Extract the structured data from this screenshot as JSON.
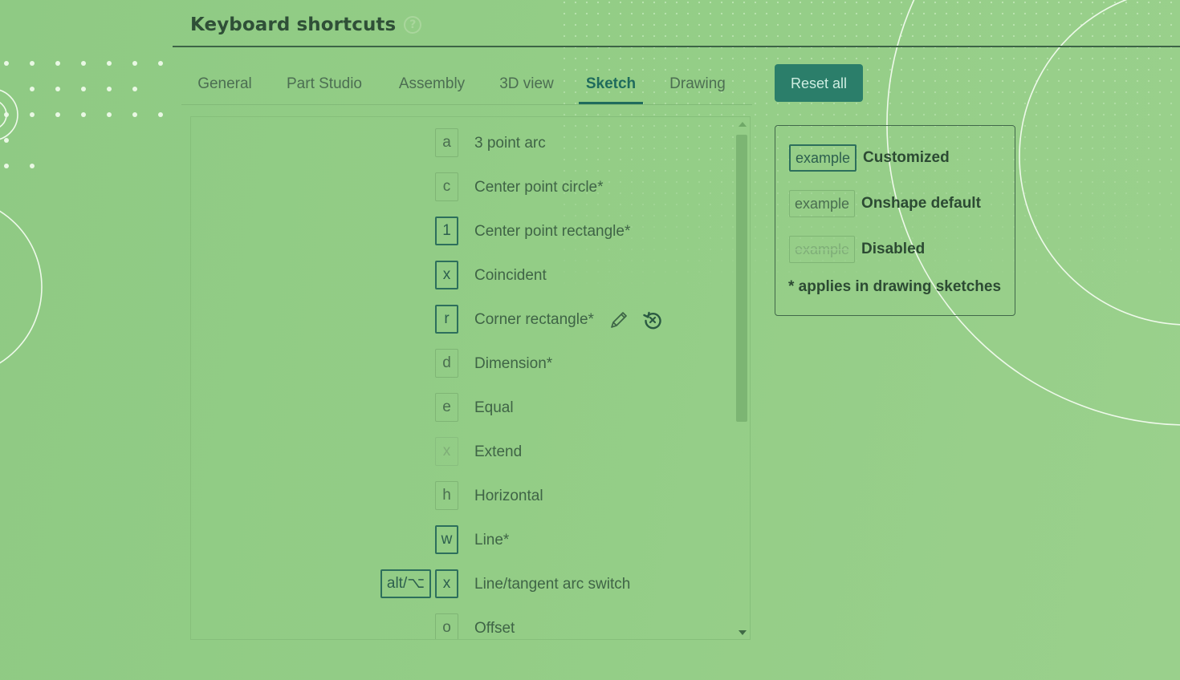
{
  "header": {
    "title": "Keyboard shortcuts",
    "help_glyph": "?"
  },
  "tabs": [
    {
      "label": "General",
      "active": false
    },
    {
      "label": "Part Studio",
      "active": false
    },
    {
      "label": "Assembly",
      "active": false
    },
    {
      "label": "3D view",
      "active": false
    },
    {
      "label": "Sketch",
      "active": true
    },
    {
      "label": "Drawing",
      "active": false
    }
  ],
  "toolbar": {
    "reset_label": "Reset all"
  },
  "shortcuts": [
    {
      "modifier": "",
      "key": "a",
      "state": "default",
      "label": "3 point arc"
    },
    {
      "modifier": "",
      "key": "c",
      "state": "default",
      "label": "Center point circle*"
    },
    {
      "modifier": "",
      "key": "1",
      "state": "custom",
      "label": "Center point rectangle*"
    },
    {
      "modifier": "",
      "key": "x",
      "state": "custom",
      "label": "Coincident"
    },
    {
      "modifier": "",
      "key": "r",
      "state": "custom",
      "label": "Corner rectangle*",
      "icons": [
        "pencil-icon",
        "reset-icon"
      ]
    },
    {
      "modifier": "",
      "key": "d",
      "state": "default",
      "label": "Dimension*"
    },
    {
      "modifier": "",
      "key": "e",
      "state": "default",
      "label": "Equal"
    },
    {
      "modifier": "",
      "key": "x",
      "state": "disabled",
      "label": "Extend"
    },
    {
      "modifier": "",
      "key": "h",
      "state": "default",
      "label": "Horizontal"
    },
    {
      "modifier": "",
      "key": "w",
      "state": "custom",
      "label": "Line*"
    },
    {
      "modifier": "alt/⌥",
      "key": "x",
      "state": "custom",
      "label": "Line/tangent arc switch"
    },
    {
      "modifier": "",
      "key": "o",
      "state": "default",
      "label": "Offset"
    }
  ],
  "legend": {
    "items": [
      {
        "example": "example",
        "state": "custom",
        "label": "Customized"
      },
      {
        "example": "example",
        "state": "default",
        "label": "Onshape default"
      },
      {
        "example": "example",
        "state": "disabled",
        "label": "Disabled"
      }
    ],
    "note": "* applies in drawing sketches"
  },
  "colors": {
    "accent": "#2b7e6a",
    "active_tab": "#1f6b5c",
    "background": "#93cd86"
  }
}
